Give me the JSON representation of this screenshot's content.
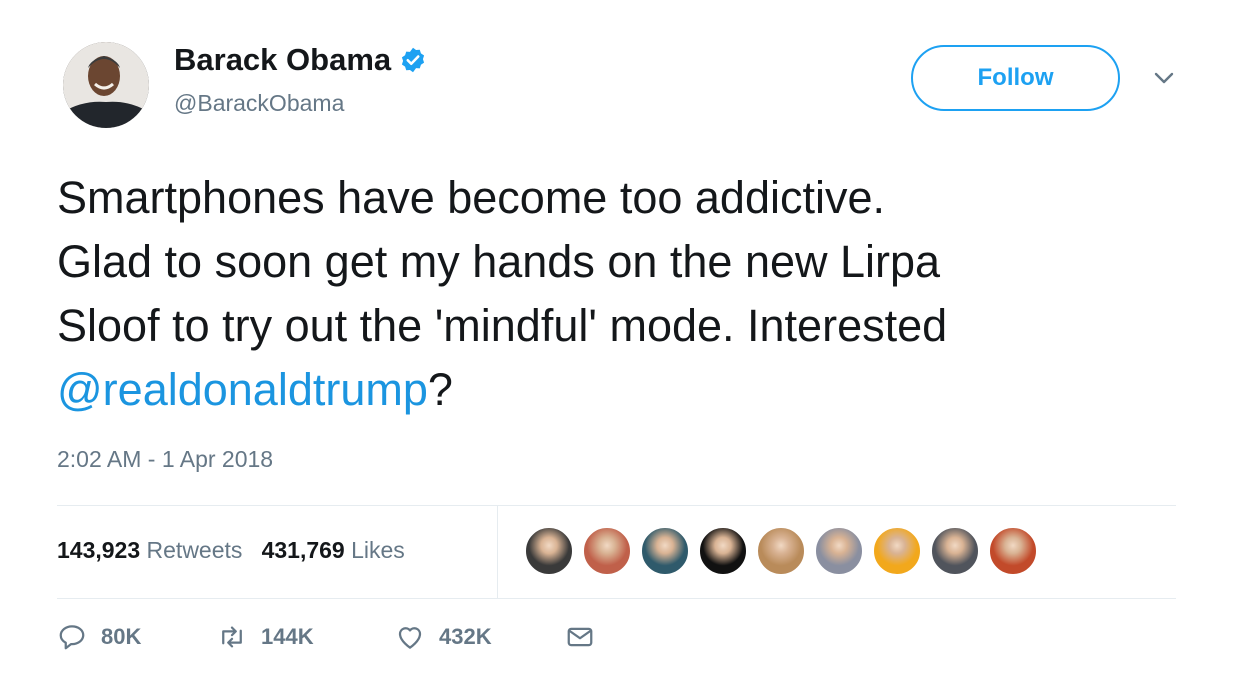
{
  "author": {
    "name": "Barack Obama",
    "handle": "@BarackObama",
    "verified": true
  },
  "follow_label": "Follow",
  "tweet": {
    "text_before": "Smartphones have become too addictive.\nGlad to soon get my hands on the new Lirpa\nSloof to try out the 'mindful' mode. Interested\n",
    "mention": "@realdonaldtrump",
    "text_after": "?",
    "timestamp": "2:02 AM - 1 Apr 2018"
  },
  "stats": {
    "retweets_count": "143,923",
    "retweets_label": "Retweets",
    "likes_count": "431,769",
    "likes_label": "Likes"
  },
  "liker_avatars": [
    {
      "color": "#3a3a3a"
    },
    {
      "color": "#c0604a"
    },
    {
      "color": "#2f5a6b"
    },
    {
      "color": "#111111"
    },
    {
      "color": "#b98b5a"
    },
    {
      "color": "#8a8fa0"
    },
    {
      "color": "#f2a81c"
    },
    {
      "color": "#50545c"
    },
    {
      "color": "#c24a2a"
    }
  ],
  "actions": {
    "reply_count": "80K",
    "retweet_count": "144K",
    "like_count": "432K"
  },
  "colors": {
    "accent": "#1da1f2",
    "mention": "#1b95e0",
    "muted": "#657786"
  }
}
